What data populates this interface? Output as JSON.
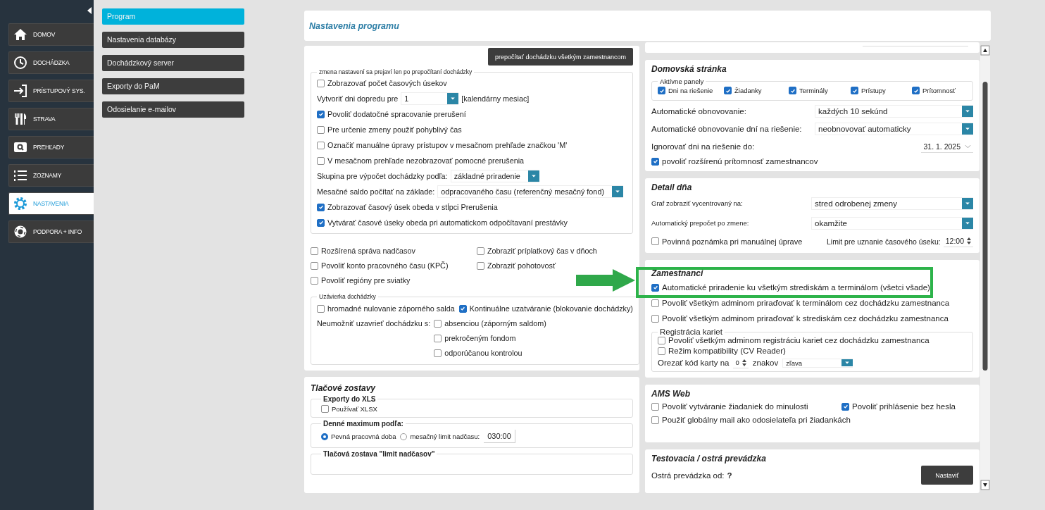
{
  "sidebar": {
    "items": [
      {
        "label": "DOMOV",
        "selected": false
      },
      {
        "label": "DOCHÁDZKA",
        "selected": false
      },
      {
        "label": "PRÍSTUPOVÝ SYS.",
        "selected": false
      },
      {
        "label": "STRAVA",
        "selected": false
      },
      {
        "label": "PREHĽADY",
        "selected": false
      },
      {
        "label": "ZOZNAMY",
        "selected": false
      },
      {
        "label": "NASTAVENIA",
        "selected": true
      },
      {
        "label": "PODPORA + INFO",
        "selected": false
      }
    ]
  },
  "submenu": [
    {
      "label": "Program",
      "selected": true
    },
    {
      "label": "Nastavenia databázy",
      "selected": false
    },
    {
      "label": "Dochádzkový server",
      "selected": false
    },
    {
      "label": "Exporty do PaM",
      "selected": false
    },
    {
      "label": "Odosielanie e-mailov",
      "selected": false
    }
  ],
  "title": "Nastavenia programu",
  "recalc_button": "prepočítať dochádzku všetkým zamestnancom",
  "recalc_group": {
    "legend": "zmena nastavení sa prejaví len po prepočítaní dochádzky",
    "rows": [
      {
        "kind": "checkbox",
        "label": "Zobrazovať počet časových úsekov",
        "checked": false
      },
      {
        "kind": "select",
        "label": "Vytvoriť dni dopredu pre",
        "value": "1",
        "suffix": "[kalendárny mesiac]"
      },
      {
        "kind": "checkbox",
        "label": "Povoliť dodatočné spracovanie prerušení",
        "checked": true
      },
      {
        "kind": "checkbox",
        "label": "Pre určenie zmeny použiť pohyblivý čas",
        "checked": false
      },
      {
        "kind": "checkbox",
        "label": "Označiť manuálne úpravy prístupov v mesačnom prehľade značkou 'M'",
        "checked": false
      },
      {
        "kind": "checkbox",
        "label": "V mesačnom prehľade nezobrazovať pomocné prerušenia",
        "checked": false
      },
      {
        "kind": "select",
        "label": "Skupina pre výpočet dochádzky podľa:",
        "value": "základné priradenie"
      },
      {
        "kind": "select",
        "label": "Mesačné saldo počítať na základe:",
        "value": "odpracovaného času (referenčný mesačný fond)"
      },
      {
        "kind": "checkbox",
        "label": "Zobrazovať časový úsek obeda v stĺpci Prerušenia",
        "checked": true
      },
      {
        "kind": "checkbox",
        "label": "Vytvárať časové úseky obeda pri automatickom odpočítavaní prestávky",
        "checked": true
      }
    ]
  },
  "extra_options": [
    {
      "label": "Rozšírená správa nadčasov",
      "checked": false
    },
    {
      "label": "Zobraziť príplatkový čas v dňoch",
      "checked": false
    },
    {
      "label": "Povoliť konto pracovného času (KPČ)",
      "checked": false
    },
    {
      "label": "Zobraziť pohotovosť",
      "checked": false
    },
    {
      "label": "Povoliť regióny pre sviatky",
      "checked": false
    }
  ],
  "closing": {
    "legend": "Uzávierka dochádzky",
    "options": [
      {
        "label": "hromadné nulovanie záporného salda",
        "checked": false
      },
      {
        "label": "Kontinuálne uzatváranie (blokovanie dochádzky)",
        "checked": true
      }
    ],
    "block_label": "Neumožniť uzavrieť dochádzku s:",
    "block_options": [
      {
        "label": "absenciou (záporným saldom)",
        "checked": false
      },
      {
        "label": "prekročeným fondom",
        "checked": false
      },
      {
        "label": "odporúčanou kontrolou",
        "checked": false
      }
    ]
  },
  "print_reports": {
    "title": "Tlačové zostavy",
    "xls_legend": "Exporty do XLS",
    "xls_option": {
      "label": "Používať XLSX",
      "checked": false
    },
    "daily_max_legend": "Denné maximum podľa:",
    "daily_max": [
      {
        "label": "Pevná pracovná doba",
        "selected": true
      },
      {
        "label": "mesačný limit nadčasu:",
        "selected": false
      }
    ],
    "limit": "030:00",
    "report_legend": "Tlačová zostava \"limit nadčasov\""
  },
  "home": {
    "title": "Domovská stránka",
    "panels_legend": "Aktívne panely",
    "panels": [
      {
        "label": "Dni na riešenie",
        "checked": true
      },
      {
        "label": "Žiadanky",
        "checked": true
      },
      {
        "label": "Terminály",
        "checked": true
      },
      {
        "label": "Prístupy",
        "checked": true
      },
      {
        "label": "Prítomnosť",
        "checked": true
      }
    ],
    "settings": [
      {
        "kind": "select",
        "label": "Automatické obnovovanie:",
        "value": "každých 10 sekúnd"
      },
      {
        "kind": "select",
        "label": "Automatické obnovovanie dní na riešenie:",
        "value": "neobnovovať automaticky"
      },
      {
        "kind": "date",
        "label": "Ignorovať dni na riešenie do:",
        "value": "31. 1. 2025"
      }
    ],
    "extended_presence": {
      "label": "povoliť rozšírenú prítomnosť zamestnancov",
      "checked": true
    }
  },
  "day_detail": {
    "title": "Detail dňa",
    "settings": [
      {
        "label": "Graf zobraziť vycentrovaný na:",
        "value": "stred odrobenej zmeny"
      },
      {
        "label": "Automatický prepočet po zmene:",
        "value": "okamžite"
      }
    ],
    "note": {
      "label": "Povinná poznámka pri manuálnej úprave",
      "checked": false
    },
    "limit_label": "Limit pre uznanie časového úseku:",
    "limit": "12:00"
  },
  "employees": {
    "title": "Zamestnanci",
    "options": [
      {
        "label": "Automatické priradenie ku všetkým strediskám a terminálom (všetci všade)",
        "checked": true
      },
      {
        "label": "Povoliť všetkým adminom priraďovať k terminálom cez dochádzku zamestnanca",
        "checked": false
      },
      {
        "label": "Povoliť všetkým adminom priraďovať k strediskám cez dochádzku zamestnanca",
        "checked": false
      }
    ],
    "cards_legend": "Registrácia kariet",
    "card_options": [
      {
        "label": "Povoliť všetkým adminom registráciu kariet cez dochádzku zamestnanca",
        "checked": false
      },
      {
        "label": "Režim kompatibility (CV Reader)",
        "checked": false
      }
    ],
    "trim_label": "Orezať kód karty na",
    "trim_count": "0",
    "trim_unit": "znakov",
    "trim_side": "zľava"
  },
  "ams_web": {
    "title": "AMS Web",
    "options": [
      {
        "label": "Povoliť vytváranie žiadaniek do minulosti",
        "checked": false
      },
      {
        "label": "Povoliť prihlásenie bez hesla",
        "checked": true
      },
      {
        "label": "Použiť globálny mail ako odosielateľa pri žiadankách",
        "checked": false
      }
    ]
  },
  "live": {
    "title": "Testovacia / ostrá prevádzka",
    "label": "Ostrá prevádzka od:",
    "value": "?",
    "button": "Nastaviť"
  }
}
